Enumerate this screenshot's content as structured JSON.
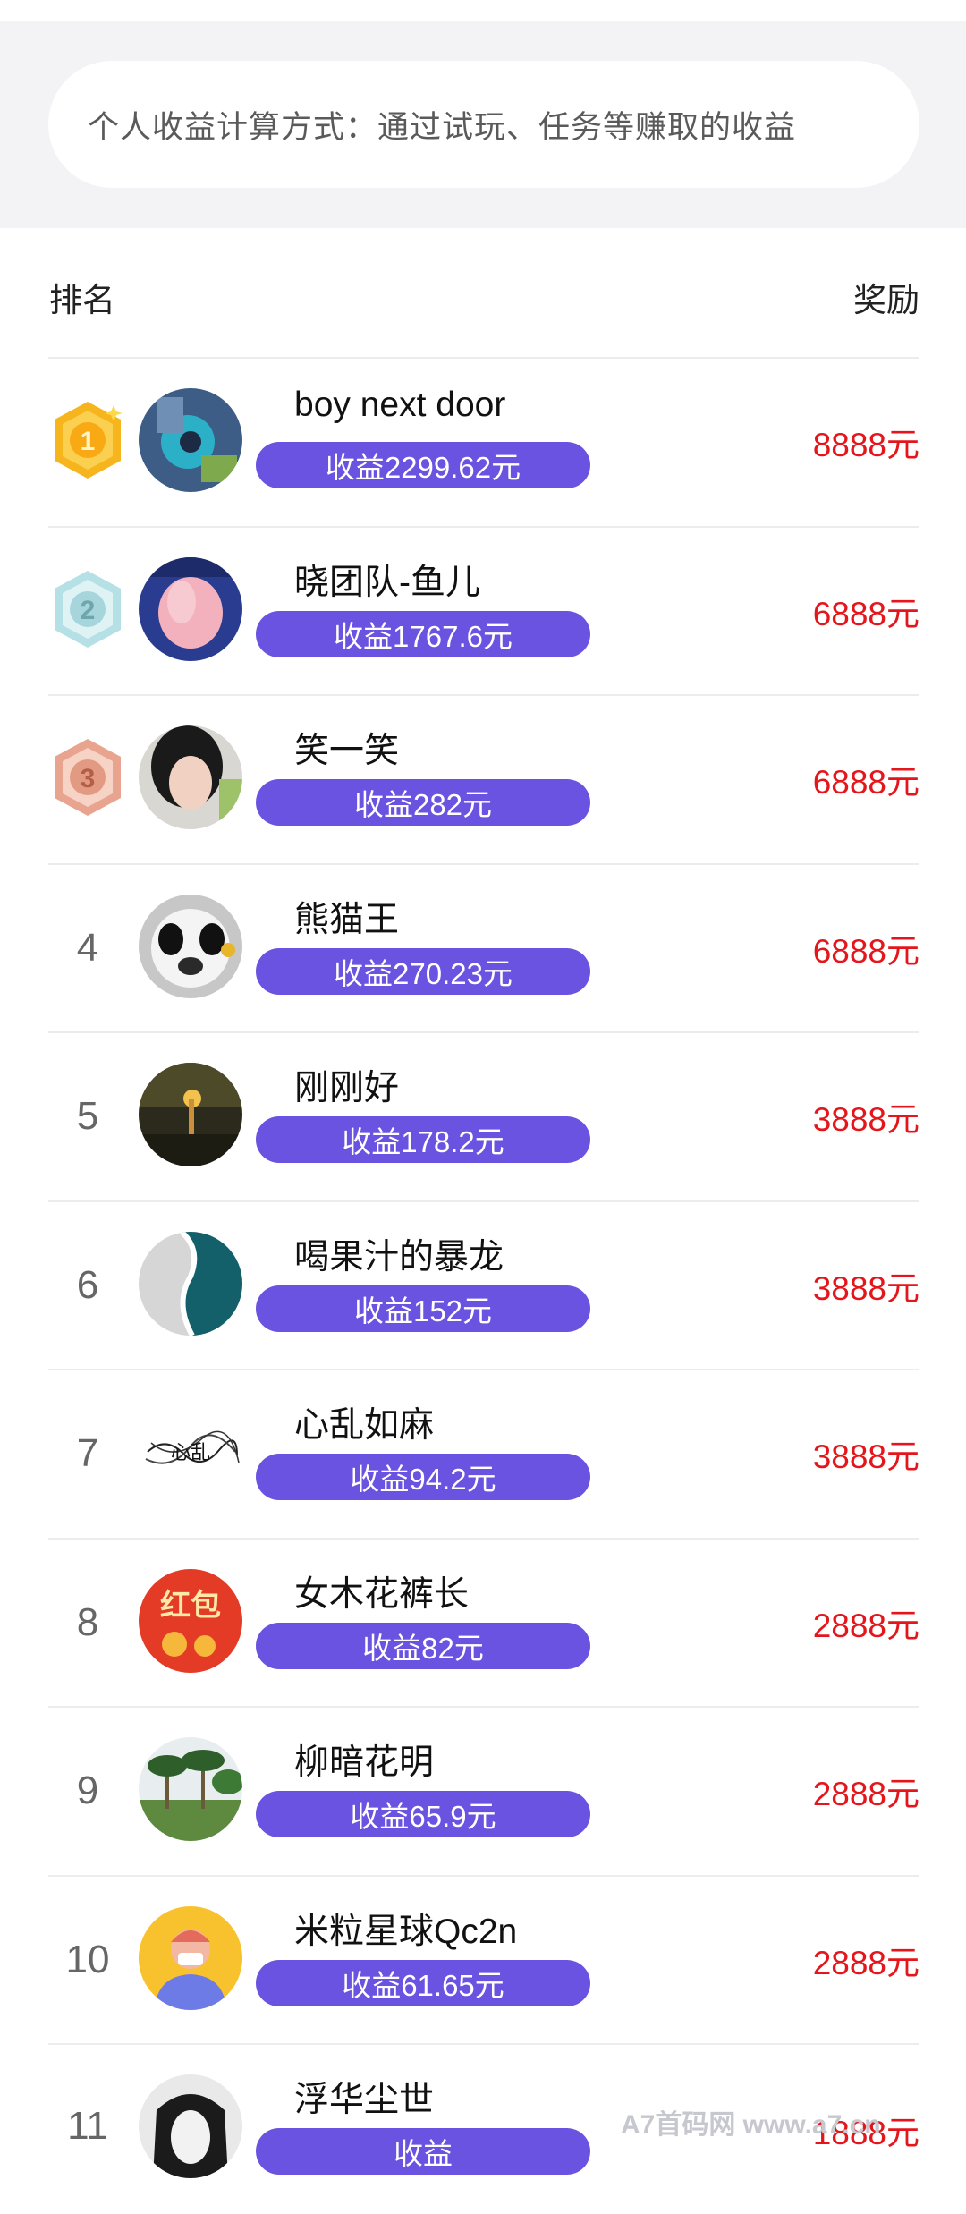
{
  "banner": {
    "info_text": "个人收益计算方式：通过试玩、任务等赚取的收益"
  },
  "header": {
    "rank_label": "排名",
    "reward_label": "奖励"
  },
  "rows": [
    {
      "rank": "1",
      "medal": "gold",
      "name": "boy next door",
      "earnings": "收益2299.62元",
      "reward": "8888元",
      "avatar": "avatar-blue-photo"
    },
    {
      "rank": "2",
      "medal": "silver",
      "name": "晓团队-鱼儿",
      "earnings": "收益1767.6元",
      "reward": "6888元",
      "avatar": "avatar-pink-photo"
    },
    {
      "rank": "3",
      "medal": "bronze",
      "name": "笑一笑",
      "earnings": "收益282元",
      "reward": "6888元",
      "avatar": "avatar-girl-photo"
    },
    {
      "rank": "4",
      "medal": "",
      "name": "熊猫王",
      "earnings": "收益270.23元",
      "reward": "6888元",
      "avatar": "avatar-panda"
    },
    {
      "rank": "5",
      "medal": "",
      "name": "刚刚好",
      "earnings": "收益178.2元",
      "reward": "3888元",
      "avatar": "avatar-sunset"
    },
    {
      "rank": "6",
      "medal": "",
      "name": "喝果汁的暴龙",
      "earnings": "收益152元",
      "reward": "3888元",
      "avatar": "avatar-ocean"
    },
    {
      "rank": "7",
      "medal": "",
      "name": "心乱如麻",
      "earnings": "收益94.2元",
      "reward": "3888元",
      "avatar": "avatar-scribble"
    },
    {
      "rank": "8",
      "medal": "",
      "name": "女木花裤长",
      "earnings": "收益82元",
      "reward": "2888元",
      "avatar": "avatar-red-envelope"
    },
    {
      "rank": "9",
      "medal": "",
      "name": "柳暗花明",
      "earnings": "收益65.9元",
      "reward": "2888元",
      "avatar": "avatar-palm-trees"
    },
    {
      "rank": "10",
      "medal": "",
      "name": "米粒星球Qc2n",
      "earnings": "收益61.65元",
      "reward": "2888元",
      "avatar": "avatar-cartoon-person"
    },
    {
      "rank": "11",
      "medal": "",
      "name": "浮华尘世",
      "earnings": "收益",
      "reward": "1888元",
      "avatar": "avatar-bw-girl"
    }
  ],
  "avatar_glyphs": {
    "red_envelope": "红包",
    "scribble": "心乱"
  },
  "watermark": "A7首码网   www.a7.cn",
  "colors": {
    "accent_purple": "#6b53e1",
    "reward_red": "#e4161b",
    "background_gray": "#f3f3f6"
  }
}
